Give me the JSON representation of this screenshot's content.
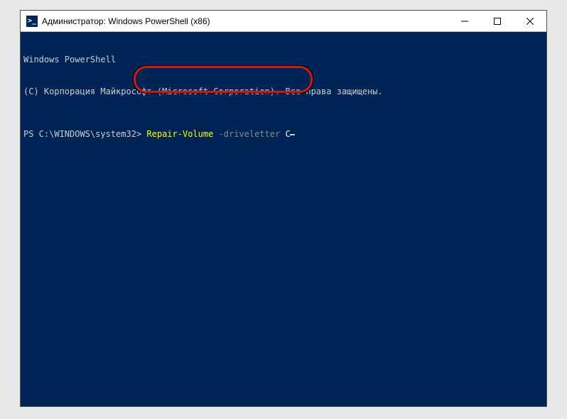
{
  "titlebar": {
    "icon_glyph": ">_",
    "title": "Администратор: Windows PowerShell (x86)"
  },
  "terminal": {
    "header_line1": "Windows PowerShell",
    "header_line2": "(С) Корпорация Майкрософт (Microsoft Corporation). Все права защищены.",
    "prompt": "PS C:\\WINDOWS\\system32> ",
    "cmd_verb": "Repair-Volume",
    "cmd_param": " -driveletter",
    "cmd_value": " C"
  }
}
